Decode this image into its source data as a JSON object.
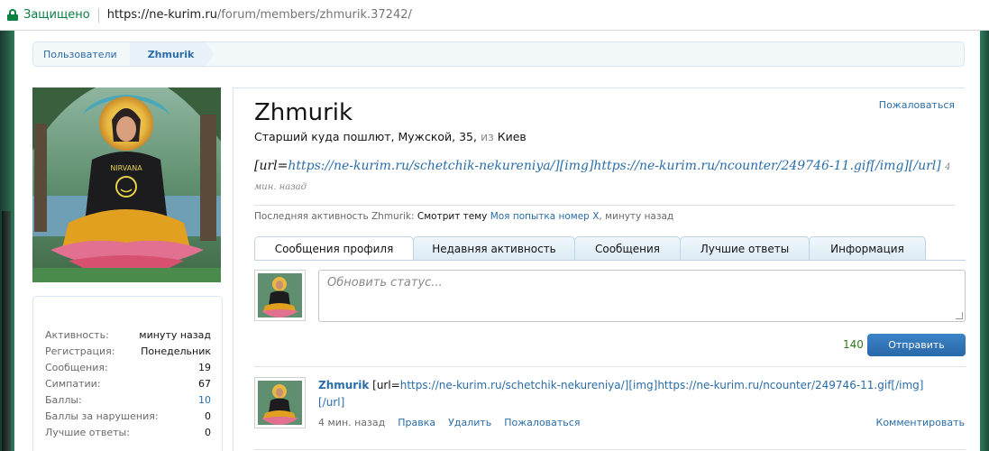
{
  "browser": {
    "secure_label": "Защищено",
    "url_host": "https://ne-kurim.ru",
    "url_path": "/forum/members/zhmurik.37242/"
  },
  "breadcrumb": {
    "items": [
      "Пользователи",
      "Zhmurik"
    ]
  },
  "avatar": {
    "description_icon": "avatar-image"
  },
  "stats": [
    {
      "label": "Активность:",
      "value": "минуту назад"
    },
    {
      "label": "Регистрация:",
      "value": "Понедельник"
    },
    {
      "label": "Сообщения:",
      "value": "19"
    },
    {
      "label": "Симпатии:",
      "value": "67"
    },
    {
      "label": "Баллы:",
      "value": "10"
    },
    {
      "label": "Баллы за нарушения:",
      "value": "0"
    },
    {
      "label": "Лучшие ответы:",
      "value": "0"
    }
  ],
  "profile": {
    "username": "Zhmurik",
    "report_label": "Пожаловаться",
    "title": "Старший куда пошлют",
    "gender": "Мужской",
    "age": "35",
    "from_label": "из",
    "location": "Киев",
    "status_prefix": "[url=",
    "status_link": "https://ne-kurim.ru/schetchik-nekureniya/][img]https://ne-kurim.ru/ncounter/249746-11.gif[/img][/url]",
    "status_time": "4 мин. назад",
    "last_activity_label": "Последняя активность Zhmurik:",
    "last_activity_action": "Смотрит тему",
    "last_activity_thread": "Моя попытка номер Х",
    "last_activity_time": "минуту назад"
  },
  "tabs": [
    {
      "label": "Сообщения профиля",
      "active": true
    },
    {
      "label": "Недавняя активность",
      "active": false
    },
    {
      "label": "Сообщения",
      "active": false
    },
    {
      "label": "Лучшие ответы",
      "active": false
    },
    {
      "label": "Информация",
      "active": false
    }
  ],
  "composer": {
    "placeholder": "Обновить статус...",
    "counter": "140",
    "submit_label": "Отправить"
  },
  "post": {
    "author": "Zhmurik",
    "text_prefix": "[url=",
    "text_link": "https://ne-kurim.ru/schetchik-nekureniya/][img]https://ne-kurim.ru/ncounter/249746-11.gif[/img][/url]",
    "time": "4 мин. назад",
    "edit_label": "Правка",
    "delete_label": "Удалить",
    "report_label": "Пожаловаться",
    "comment_label": "Комментировать"
  },
  "colors": {
    "accent": "#2b6da8",
    "secure": "#0b8043",
    "button": "#2e6fb1"
  }
}
